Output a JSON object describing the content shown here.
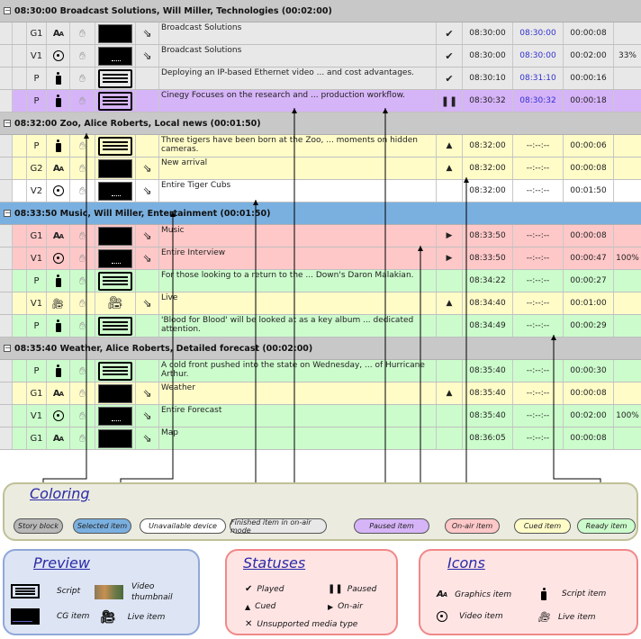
{
  "stories": [
    {
      "title": "08:30:00  Broadcast Solutions, Will Miller, Technologies (00:02:00)",
      "state": "story",
      "items": [
        {
          "channel": "G1",
          "icon": "graphics-icon",
          "preview": "cg",
          "arrow": true,
          "text": "Broadcast Solutions",
          "status": "played",
          "status_glyph": "✔",
          "time1": "08:30:00",
          "time2": "08:30:00",
          "time2_blue": true,
          "duration": "00:00:08",
          "percent": "",
          "color": "grey"
        },
        {
          "channel": "V1",
          "icon": "video-icon",
          "preview": "video",
          "arrow": true,
          "text": "Broadcast Solutions",
          "status": "played",
          "status_glyph": "✔",
          "time1": "08:30:00",
          "time2": "08:30:00",
          "time2_blue": true,
          "duration": "00:02:00",
          "percent": "33%",
          "color": "grey"
        },
        {
          "channel": "P",
          "icon": "script-icon",
          "preview": "script",
          "arrow": false,
          "text": "Deploying an IP-based Ethernet video ... and cost advantages.",
          "status": "played",
          "status_glyph": "✔",
          "time1": "08:30:10",
          "time2": "08:31:10",
          "time2_blue": true,
          "duration": "00:00:16",
          "percent": "",
          "color": "grey"
        },
        {
          "channel": "P",
          "icon": "script-icon",
          "preview": "script",
          "arrow": false,
          "text": "Cinegy Focuses on the research and ... production workflow.",
          "status": "paused",
          "status_glyph": "❚❚",
          "time1": "08:30:32",
          "time2": "08:30:32",
          "time2_blue": true,
          "duration": "00:00:18",
          "percent": "",
          "color": "purple"
        }
      ]
    },
    {
      "title": "08:32:00  Zoo, Alice Roberts, Local news (00:01:50)",
      "state": "story",
      "items": [
        {
          "channel": "P",
          "icon": "script-icon",
          "preview": "script",
          "arrow": false,
          "text": "Three tigers have been born at the Zoo, ... moments on hidden cameras.",
          "status": "cued",
          "status_glyph": "▲",
          "time1": "08:32:00",
          "time2": "--:--:--",
          "time2_blue": false,
          "duration": "00:00:06",
          "percent": "",
          "color": "yellow"
        },
        {
          "channel": "G2",
          "icon": "graphics-icon",
          "preview": "cg",
          "arrow": true,
          "text": "New arrival",
          "status": "cued",
          "status_glyph": "▲",
          "time1": "08:32:00",
          "time2": "--:--:--",
          "time2_blue": false,
          "duration": "00:00:08",
          "percent": "",
          "color": "yellow"
        },
        {
          "channel": "V2",
          "icon": "video-icon",
          "preview": "video",
          "arrow": true,
          "text": "Entire Tiger Cubs",
          "status": "",
          "status_glyph": "",
          "time1": "08:32:00",
          "time2": "--:--:--",
          "time2_blue": false,
          "duration": "00:01:50",
          "percent": "",
          "color": "white"
        }
      ]
    },
    {
      "title": "08:33:50  Music, Will Miller, Entertainment (00:01:50)",
      "state": "selected",
      "items": [
        {
          "channel": "G1",
          "icon": "graphics-icon",
          "preview": "cg",
          "arrow": true,
          "text": "Music",
          "status": "on-air",
          "status_glyph": "▶",
          "time1": "08:33:50",
          "time2": "--:--:--",
          "time2_blue": false,
          "duration": "00:00:08",
          "percent": "",
          "color": "red"
        },
        {
          "channel": "V1",
          "icon": "video-icon",
          "preview": "video",
          "arrow": true,
          "text": "Entire Interview",
          "status": "on-air",
          "status_glyph": "▶",
          "time1": "08:33:50",
          "time2": "--:--:--",
          "time2_blue": false,
          "duration": "00:00:47",
          "percent": "100%",
          "color": "red"
        },
        {
          "channel": "P",
          "icon": "script-icon",
          "preview": "script",
          "arrow": false,
          "text": "For those looking to a return to the ... Down's Daron Malakian.",
          "status": "",
          "status_glyph": "",
          "time1": "08:34:22",
          "time2": "--:--:--",
          "time2_blue": false,
          "duration": "00:00:27",
          "percent": "",
          "color": "green"
        },
        {
          "channel": "V1",
          "icon": "live-icon",
          "preview": "live",
          "arrow": true,
          "text": "Live",
          "status": "cued",
          "status_glyph": "▲",
          "time1": "08:34:40",
          "time2": "--:--:--",
          "time2_blue": false,
          "duration": "00:01:00",
          "percent": "",
          "color": "yellow"
        },
        {
          "channel": "P",
          "icon": "script-icon",
          "preview": "script",
          "arrow": false,
          "text": "'Blood for Blood' will be looked at as a key album ... dedicated attention.",
          "status": "",
          "status_glyph": "",
          "time1": "08:34:49",
          "time2": "--:--:--",
          "time2_blue": false,
          "duration": "00:00:29",
          "percent": "",
          "color": "green"
        }
      ]
    },
    {
      "title": "08:35:40  Weather, Alice Roberts, Detailed forecast (00:02:00)",
      "state": "story",
      "items": [
        {
          "channel": "P",
          "icon": "script-icon",
          "preview": "script",
          "arrow": false,
          "text": "A cold front pushed into the state on Wednesday, ... of Hurricane Arthur.",
          "status": "",
          "status_glyph": "",
          "time1": "08:35:40",
          "time2": "--:--:--",
          "time2_blue": false,
          "duration": "00:00:30",
          "percent": "",
          "color": "green"
        },
        {
          "channel": "G1",
          "icon": "graphics-icon",
          "preview": "cg",
          "arrow": true,
          "text": "Weather",
          "status": "cued",
          "status_glyph": "▲",
          "time1": "08:35:40",
          "time2": "--:--:--",
          "time2_blue": false,
          "duration": "00:00:08",
          "percent": "",
          "color": "yellow"
        },
        {
          "channel": "V1",
          "icon": "video-icon",
          "preview": "video",
          "arrow": true,
          "text": "Entire Forecast",
          "status": "",
          "status_glyph": "",
          "time1": "08:35:40",
          "time2": "--:--:--",
          "time2_blue": false,
          "duration": "00:02:00",
          "percent": "100%",
          "color": "green"
        },
        {
          "channel": "G1",
          "icon": "graphics-icon",
          "preview": "cg",
          "arrow": true,
          "text": "Map",
          "status": "",
          "status_glyph": "",
          "time1": "08:36:05",
          "time2": "--:--:--",
          "time2_blue": false,
          "duration": "00:00:08",
          "percent": "",
          "color": "green"
        }
      ]
    }
  ],
  "coloring": {
    "title": "Coloring",
    "items": [
      {
        "label": "Story block",
        "color": "#b8b8b8"
      },
      {
        "label": "Selected item",
        "color": "#7ab0e0"
      },
      {
        "label": "Unavailable device",
        "color": "#ffffff"
      },
      {
        "label": "Finished item in on-air mode",
        "color": "#e8e8e8"
      },
      {
        "label": "Paused item",
        "color": "#d6b4f8"
      },
      {
        "label": "On-air item",
        "color": "#ffc8c8"
      },
      {
        "label": "Cued item",
        "color": "#fffcc8"
      },
      {
        "label": "Ready item",
        "color": "#ccfccc"
      }
    ]
  },
  "preview_legend": {
    "title": "Preview",
    "script": "Script",
    "video_thumbnail": "Video thumbnail",
    "cg_item": "CG item",
    "live_item": "Live item"
  },
  "statuses_legend": {
    "title": "Statuses",
    "played": "Played",
    "paused": "Paused",
    "cued": "Cued",
    "on_air": "On-air",
    "unsupported": "Unsupported media type"
  },
  "icons_legend": {
    "title": "Icons",
    "graphics": "Graphics item",
    "script": "Script item",
    "video": "Video item",
    "live": "Live item"
  },
  "colors": {
    "story": "#c8c8c8",
    "selected": "#7ab0e0",
    "time_blue": "#3030d0",
    "title_blue": "#2a2aa8"
  }
}
